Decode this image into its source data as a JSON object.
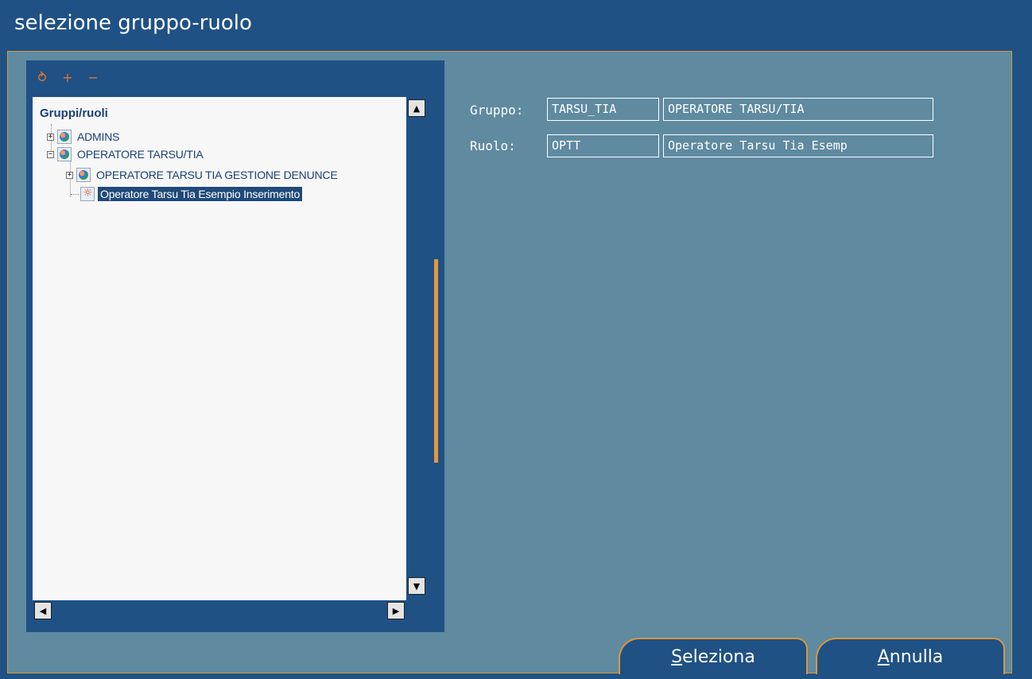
{
  "window": {
    "title": "selezione gruppo-ruolo"
  },
  "toolbar": {
    "buttons": [
      {
        "icon": "refresh-icon",
        "glyph": "⥁"
      },
      {
        "icon": "expand-all-icon",
        "glyph": "+"
      },
      {
        "icon": "collapse-all-icon",
        "glyph": "−"
      }
    ]
  },
  "tree": {
    "root_label": "Gruppi/ruoli",
    "nodes": [
      {
        "label": "ADMINS",
        "expander": "+"
      },
      {
        "label": "OPERATORE TARSU/TIA",
        "expander": "−"
      },
      {
        "label": "OPERATORE TARSU TIA GESTIONE DENUNCE",
        "expander": "+"
      },
      {
        "label": "Operatore Tarsu Tia Esempio Inserimento",
        "selected": true
      }
    ]
  },
  "scroll": {
    "up": "▲",
    "down": "▼",
    "left": "◀",
    "right": "▶"
  },
  "details": {
    "gruppo_label": "Gruppo:",
    "gruppo_code": "TARSU_TIA",
    "gruppo_name": "OPERATORE TARSU/TIA",
    "ruolo_label": "Ruolo:",
    "ruolo_code": "OPTT",
    "ruolo_name": "Operatore Tarsu Tia Esemp"
  },
  "buttons": {
    "select_first": "S",
    "select_rest": "eleziona",
    "cancel_first": "A",
    "cancel_rest": "nnulla"
  },
  "colors": {
    "frame": "#1f5185",
    "panel": "#5f8aa0",
    "accent": "#d8973e",
    "selection": "#1f4a7a"
  }
}
